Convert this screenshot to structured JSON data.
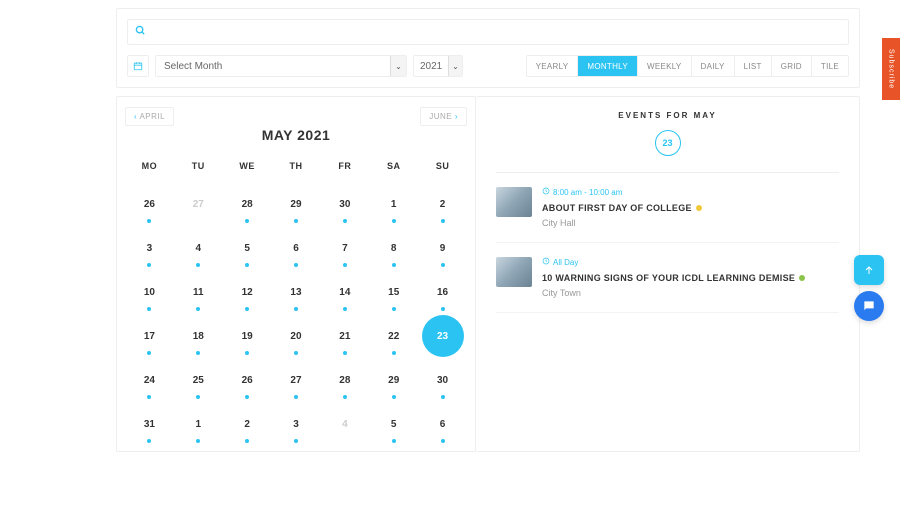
{
  "search": {
    "placeholder": ""
  },
  "filters": {
    "month_placeholder": "Select Month",
    "year": "2021",
    "views": [
      "Yearly",
      "Monthly",
      "Weekly",
      "Daily",
      "List",
      "Grid",
      "Tile"
    ],
    "active_view": "Monthly"
  },
  "nav": {
    "prev": "APRIL",
    "next": "JUNE"
  },
  "calendar": {
    "title": "MAY 2021",
    "dow": [
      "MO",
      "TU",
      "WE",
      "TH",
      "FR",
      "SA",
      "SU"
    ],
    "days": [
      {
        "n": "26",
        "out": false,
        "dot": true
      },
      {
        "n": "27",
        "out": true,
        "dot": false
      },
      {
        "n": "28",
        "out": false,
        "dot": true
      },
      {
        "n": "29",
        "out": false,
        "dot": true
      },
      {
        "n": "30",
        "out": false,
        "dot": true
      },
      {
        "n": "1",
        "out": false,
        "dot": true
      },
      {
        "n": "2",
        "out": false,
        "dot": true
      },
      {
        "n": "3",
        "out": false,
        "dot": true
      },
      {
        "n": "4",
        "out": false,
        "dot": true
      },
      {
        "n": "5",
        "out": false,
        "dot": true
      },
      {
        "n": "6",
        "out": false,
        "dot": true
      },
      {
        "n": "7",
        "out": false,
        "dot": true
      },
      {
        "n": "8",
        "out": false,
        "dot": true
      },
      {
        "n": "9",
        "out": false,
        "dot": true
      },
      {
        "n": "10",
        "out": false,
        "dot": true
      },
      {
        "n": "11",
        "out": false,
        "dot": true
      },
      {
        "n": "12",
        "out": false,
        "dot": true
      },
      {
        "n": "13",
        "out": false,
        "dot": true
      },
      {
        "n": "14",
        "out": false,
        "dot": true
      },
      {
        "n": "15",
        "out": false,
        "dot": true
      },
      {
        "n": "16",
        "out": false,
        "dot": true
      },
      {
        "n": "17",
        "out": false,
        "dot": true
      },
      {
        "n": "18",
        "out": false,
        "dot": true
      },
      {
        "n": "19",
        "out": false,
        "dot": true
      },
      {
        "n": "20",
        "out": false,
        "dot": true
      },
      {
        "n": "21",
        "out": false,
        "dot": true
      },
      {
        "n": "22",
        "out": false,
        "dot": true
      },
      {
        "n": "23",
        "out": false,
        "dot": false,
        "selected": true
      },
      {
        "n": "24",
        "out": false,
        "dot": true
      },
      {
        "n": "25",
        "out": false,
        "dot": true
      },
      {
        "n": "26",
        "out": false,
        "dot": true
      },
      {
        "n": "27",
        "out": false,
        "dot": true
      },
      {
        "n": "28",
        "out": false,
        "dot": true
      },
      {
        "n": "29",
        "out": false,
        "dot": true
      },
      {
        "n": "30",
        "out": false,
        "dot": true
      },
      {
        "n": "31",
        "out": false,
        "dot": true
      },
      {
        "n": "1",
        "out": false,
        "dot": true
      },
      {
        "n": "2",
        "out": false,
        "dot": true
      },
      {
        "n": "3",
        "out": false,
        "dot": true
      },
      {
        "n": "4",
        "out": true,
        "dot": false
      },
      {
        "n": "5",
        "out": false,
        "dot": true
      },
      {
        "n": "6",
        "out": false,
        "dot": true
      }
    ]
  },
  "events": {
    "heading": "EVENTS FOR MAY",
    "badge": "23",
    "list": [
      {
        "time": "8:00 am - 10:00 am",
        "title": "ABOUT FIRST DAY OF COLLEGE",
        "loc": "City Hall",
        "status_color": "#f0c93a"
      },
      {
        "time": "All Day",
        "title": "10 WARNING SIGNS OF YOUR ICDL LEARNING DEMISE",
        "loc": "City Town",
        "status_color": "#8bc34a"
      }
    ]
  },
  "side": {
    "subscribe": "Subscribe",
    "up": "↑",
    "chat": "💬"
  },
  "colors": {
    "accent": "#2bc4f2"
  }
}
